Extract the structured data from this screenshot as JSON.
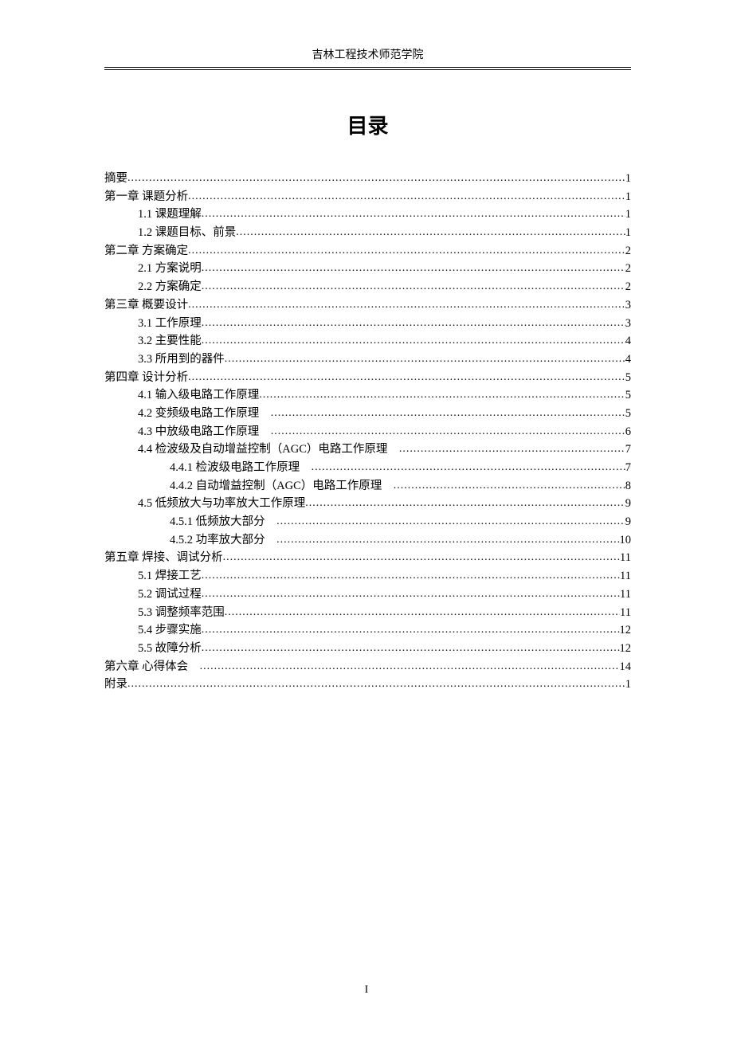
{
  "header": "吉林工程技术师范学院",
  "title": "目录",
  "footer": "I",
  "toc": [
    {
      "level": 0,
      "label": "摘要",
      "page": "1"
    },
    {
      "level": 0,
      "label": "第一章 课题分析",
      "page": "1"
    },
    {
      "level": 1,
      "label": "1.1 课题理解",
      "page": "1"
    },
    {
      "level": 1,
      "label": "1.2 课题目标、前景",
      "page": "1"
    },
    {
      "level": 0,
      "label": "第二章 方案确定",
      "page": "2"
    },
    {
      "level": 1,
      "label": "2.1 方案说明",
      "page": "2"
    },
    {
      "level": 1,
      "label": "2.2 方案确定",
      "page": "2"
    },
    {
      "level": 0,
      "label": "第三章 概要设计",
      "page": "3"
    },
    {
      "level": 1,
      "label": "3.1 工作原理",
      "page": "3"
    },
    {
      "level": 1,
      "label": "3.2 主要性能",
      "page": "4"
    },
    {
      "level": 1,
      "label": "3.3 所用到的器件",
      "page": "4"
    },
    {
      "level": 0,
      "label": "第四章 设计分析",
      "page": "5"
    },
    {
      "level": 1,
      "label": "4.1 输入级电路工作原理",
      "page": "5"
    },
    {
      "level": 1,
      "label": "4.2 变频级电路工作原理　",
      "page": "5"
    },
    {
      "level": 1,
      "label": "4.3 中放级电路工作原理　",
      "page": "6"
    },
    {
      "level": 1,
      "label": "4.4 检波级及自动增益控制（AGC）电路工作原理　",
      "page": "7"
    },
    {
      "level": 2,
      "label": "4.4.1 检波级电路工作原理　",
      "page": "7"
    },
    {
      "level": 2,
      "label": "4.4.2 自动增益控制（AGC）电路工作原理　",
      "page": "8"
    },
    {
      "level": 1,
      "label": "4.5 低频放大与功率放大工作原理",
      "page": "9"
    },
    {
      "level": 2,
      "label": "4.5.1 低频放大部分　",
      "page": "9"
    },
    {
      "level": 2,
      "label": "4.5.2 功率放大部分　",
      "page": "10"
    },
    {
      "level": 0,
      "label": "第五章 焊接、调试分析",
      "page": "11"
    },
    {
      "level": 1,
      "label": "5.1 焊接工艺",
      "page": "11"
    },
    {
      "level": 1,
      "label": "5.2 调试过程",
      "page": "11"
    },
    {
      "level": 1,
      "label": "5.3 调整频率范围",
      "page": "11"
    },
    {
      "level": 1,
      "label": "5.4 步骤实施",
      "page": "12"
    },
    {
      "level": 1,
      "label": "5.5 故障分析",
      "page": "12"
    },
    {
      "level": 0,
      "label": "第六章 心得体会　",
      "page": "14"
    },
    {
      "level": 0,
      "label": "附录",
      "page": "1"
    }
  ]
}
